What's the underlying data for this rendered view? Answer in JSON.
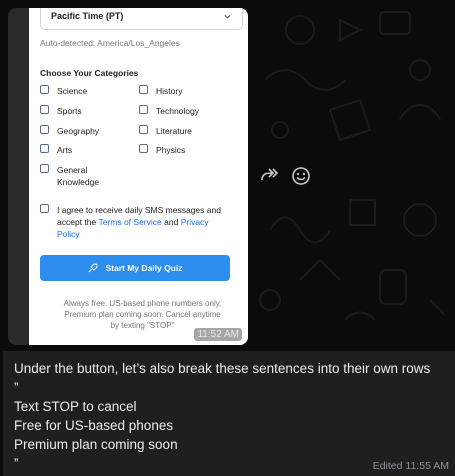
{
  "quiz_form": {
    "timezone_value": "Pacific Time (PT)",
    "auto_detected": "Auto-detected: America/Los_Angeles",
    "categories_title": "Choose Your Categories",
    "categories": [
      {
        "label": "Science",
        "checked": false
      },
      {
        "label": "History",
        "checked": false
      },
      {
        "label": "Sports",
        "checked": false
      },
      {
        "label": "Technology",
        "checked": false
      },
      {
        "label": "Geography",
        "checked": false
      },
      {
        "label": "Literature",
        "checked": false
      },
      {
        "label": "Arts",
        "checked": false
      },
      {
        "label": "Physics",
        "checked": false
      },
      {
        "label": "General Knowledge",
        "checked": false
      }
    ],
    "agree_prefix": "I agree to receive daily SMS messages and accept the",
    "terms_link": "Terms of Service",
    "agree_and": "and",
    "privacy_link": "Privacy Policy",
    "start_button": "Start My Daily Quiz",
    "fine_print_1": "Always free. US-based phone numbers only.",
    "fine_print_2": "Premium plan coming soon. Cancel anytime",
    "fine_print_3": "by texting \"STOP\""
  },
  "image_message": {
    "time": "11:52 AM",
    "forward_icon": "forward-icon",
    "reaction_icon": "emoji-reaction-icon"
  },
  "text_message": {
    "lines": [
      "Under the button, let’s also break these sentences into their own rows",
      "”",
      "Text STOP to cancel",
      "Free for US-based phones",
      "Premium plan coming soon",
      "”"
    ],
    "edited_label": "Edited 11:55 AM"
  },
  "colors": {
    "chat_background": "#0b0b0b",
    "bubble": "#1f1f1f",
    "primary_button": "#2d8ef0",
    "link": "#1a73e8"
  }
}
